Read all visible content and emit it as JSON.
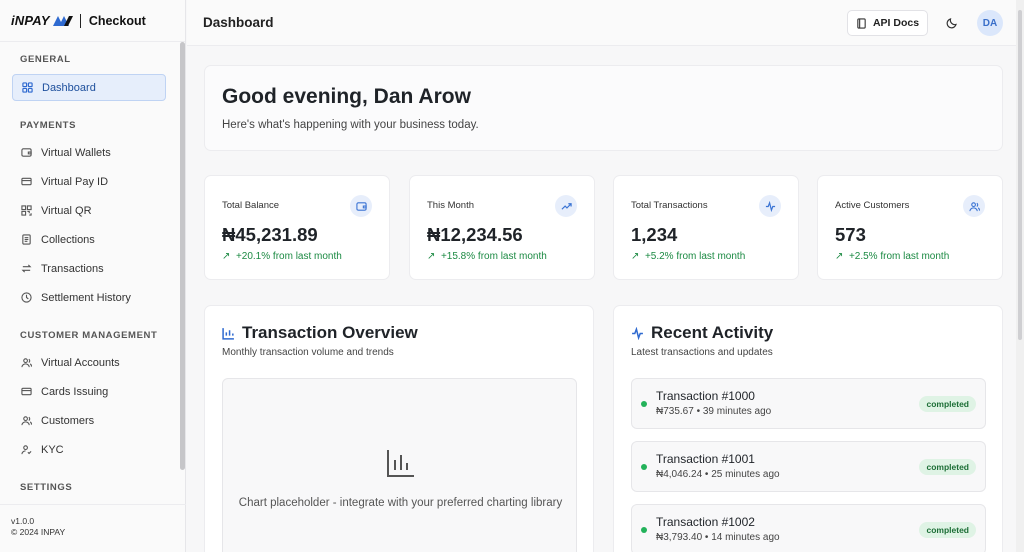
{
  "brand": {
    "logo_text": "iNPAY",
    "title": "Checkout"
  },
  "sidebar": {
    "sections": [
      {
        "title": "GENERAL",
        "items": [
          {
            "label": "Dashboard",
            "icon": "grid-icon",
            "active": true
          }
        ]
      },
      {
        "title": "PAYMENTS",
        "items": [
          {
            "label": "Virtual Wallets",
            "icon": "wallet-icon"
          },
          {
            "label": "Virtual Pay ID",
            "icon": "card-icon"
          },
          {
            "label": "Virtual QR",
            "icon": "qr-icon"
          },
          {
            "label": "Collections",
            "icon": "receipt-icon"
          },
          {
            "label": "Transactions",
            "icon": "transfer-icon"
          },
          {
            "label": "Settlement History",
            "icon": "clock-icon"
          }
        ]
      },
      {
        "title": "CUSTOMER MANAGEMENT",
        "items": [
          {
            "label": "Virtual Accounts",
            "icon": "users-icon"
          },
          {
            "label": "Cards Issuing",
            "icon": "card-icon"
          },
          {
            "label": "Customers",
            "icon": "users-icon"
          },
          {
            "label": "KYC",
            "icon": "user-check-icon"
          }
        ]
      },
      {
        "title": "SETTINGS",
        "items": []
      }
    ],
    "footer": {
      "version": "v1.0.0",
      "copyright": "© 2024 INPAY"
    }
  },
  "header": {
    "title": "Dashboard",
    "api_docs_label": "API Docs",
    "avatar_initials": "DA"
  },
  "greeting": {
    "title": "Good evening, Dan Arow",
    "subtitle": "Here's what's happening with your business today."
  },
  "stats": [
    {
      "label": "Total Balance",
      "value": "₦45,231.89",
      "change": "+20.1% from last month",
      "icon": "wallet-icon"
    },
    {
      "label": "This Month",
      "value": "₦12,234.56",
      "change": "+15.8% from last month",
      "icon": "trending-up-icon"
    },
    {
      "label": "Total Transactions",
      "value": "1,234",
      "change": "+5.2% from last month",
      "icon": "activity-icon"
    },
    {
      "label": "Active Customers",
      "value": "573",
      "change": "+2.5% from last month",
      "icon": "users-icon"
    }
  ],
  "overview": {
    "title": "Transaction Overview",
    "subtitle": "Monthly transaction volume and trends",
    "placeholder": "Chart placeholder - integrate with your preferred charting library"
  },
  "activity": {
    "title": "Recent Activity",
    "subtitle": "Latest transactions and updates",
    "items": [
      {
        "title": "Transaction #1000",
        "meta": "₦735.67 • 39 minutes ago",
        "status": "completed"
      },
      {
        "title": "Transaction #1001",
        "meta": "₦4,046.24 • 25 minutes ago",
        "status": "completed"
      },
      {
        "title": "Transaction #1002",
        "meta": "₦3,793.40 • 14 minutes ago",
        "status": "completed"
      }
    ]
  },
  "colors": {
    "accent": "#2f6ad0",
    "success": "#1c8a43",
    "badge_bg": "#dff3e5"
  }
}
